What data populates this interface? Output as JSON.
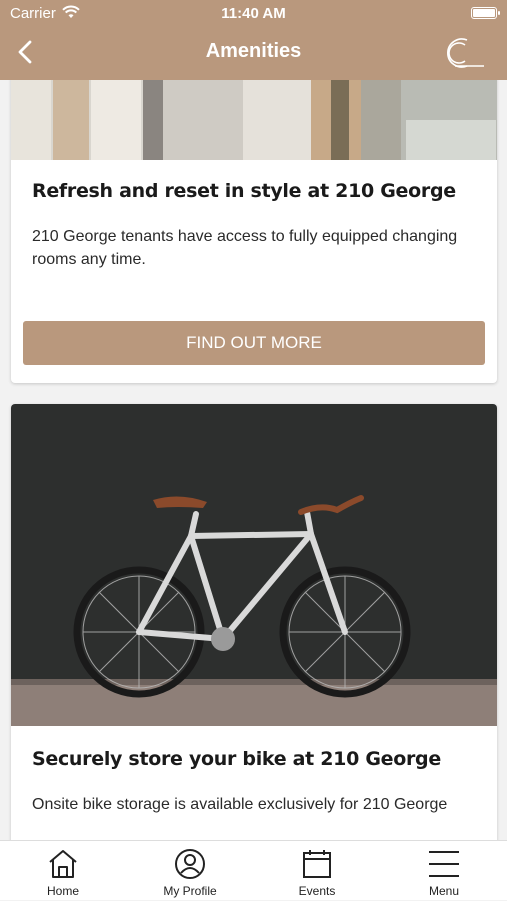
{
  "status_bar": {
    "carrier": "Carrier",
    "time": "11:40 AM"
  },
  "header": {
    "title": "Amenities"
  },
  "cards": [
    {
      "title": "Refresh and reset in style at 210 George",
      "description": "210 George tenants have access to fully equipped changing rooms any time.",
      "button_label": "FIND OUT MORE"
    },
    {
      "title": "Securely store your bike at 210 George",
      "description": "Onsite bike storage is available exclusively for 210 George"
    }
  ],
  "tabbar": [
    {
      "label": "Home",
      "icon": "home-icon"
    },
    {
      "label": "My Profile",
      "icon": "profile-icon"
    },
    {
      "label": "Events",
      "icon": "calendar-icon"
    },
    {
      "label": "Menu",
      "icon": "menu-icon"
    }
  ],
  "colors": {
    "brand": "#b9987d",
    "background": "#f2f2f2"
  }
}
